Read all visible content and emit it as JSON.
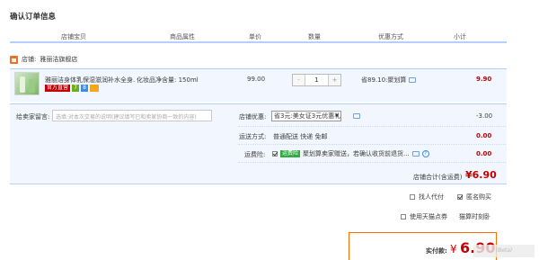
{
  "page": {
    "title": "确认订单信息"
  },
  "columns": [
    "店铺宝贝",
    "商品属性",
    "单价",
    "数量",
    "优惠方式",
    "小计"
  ],
  "shop": {
    "label": "店铺:",
    "name": "雅丽洁旗舰店"
  },
  "item": {
    "name": "雅丽洁身体乳保湿滋润补水全身...",
    "attribute": "化妆品净含量: 150ml",
    "badges": {
      "official": "官方直营",
      "seven": "7",
      "square": "8"
    },
    "price": "99.00",
    "quantity": {
      "minus": "-",
      "value": "1",
      "plus": "+"
    },
    "discount": "省89.10:聚划算",
    "subtotal": "9.90"
  },
  "memo": {
    "label": "给卖家留言:",
    "placeholder": "选填:对本次交易的说明(建议填写已和卖家协商一致的内容)"
  },
  "shop_discount": {
    "label": "店铺优惠:",
    "selected": "省3元:美女证3元优惠礼券",
    "amount": "-3.00"
  },
  "shipping": {
    "label": "运送方式:",
    "text": "普通配送 快递 免邮",
    "amount": "0.00"
  },
  "insurance": {
    "label": "运费险:",
    "tag": "运费险",
    "text": "聚划算卖家赠送，若确认收货前退货...",
    "amount": "0.00"
  },
  "shop_total": {
    "label": "店铺合计(含运费)",
    "value": "¥6.90"
  },
  "options": {
    "proxy_pay": "找人代付",
    "anonymous": "匿名购买",
    "tmall_points": "使用天猫点券",
    "tmall_points_right": "猫算时刻卧"
  },
  "payment": {
    "label": "实付款:",
    "currency": "¥",
    "value": "6.90"
  },
  "watermark": "(Beta)"
}
